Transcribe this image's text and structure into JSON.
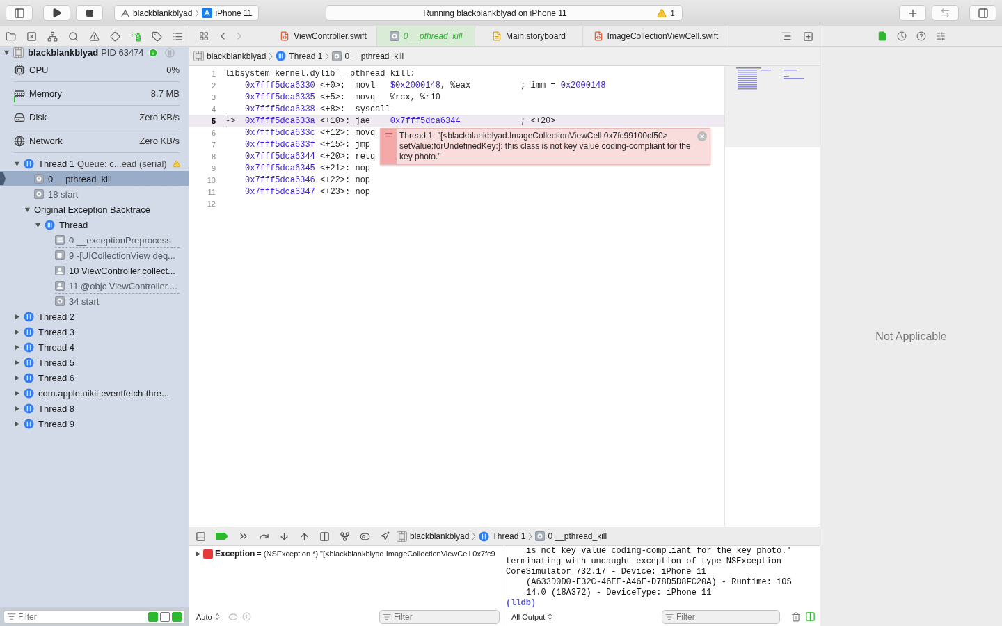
{
  "toolbar": {
    "scheme": {
      "project": "blackblankblyad",
      "device": "iPhone 11"
    },
    "activity": {
      "status": "Running blackblankblyad on iPhone 11",
      "warnings": "1"
    }
  },
  "navigator": {
    "tabs": [
      {
        "kind": "folder",
        "selected": false
      },
      {
        "kind": "source-control",
        "selected": false
      },
      {
        "kind": "symbols",
        "selected": false
      },
      {
        "kind": "find",
        "selected": false
      },
      {
        "kind": "issues",
        "selected": false
      },
      {
        "kind": "tests",
        "selected": false
      },
      {
        "kind": "debug",
        "selected": true
      },
      {
        "kind": "breakpoints",
        "selected": false
      },
      {
        "kind": "reports",
        "selected": false
      }
    ],
    "process": {
      "name": "blackblankblyad",
      "pid": "PID 63474",
      "expanded": true
    },
    "gauges": [
      {
        "kind": "cpu",
        "name": "CPU",
        "value": "0%"
      },
      {
        "kind": "memory",
        "name": "Memory",
        "value": "8.7 MB"
      },
      {
        "kind": "disk",
        "name": "Disk",
        "value": "Zero KB/s"
      },
      {
        "kind": "network",
        "name": "Network",
        "value": "Zero KB/s"
      }
    ],
    "threads": [
      {
        "kind": "thread",
        "label": "Thread 1",
        "detail": "Queue: c...ead (serial)",
        "warning": true,
        "expanded": true,
        "selected": false,
        "children": [
          {
            "kind": "system",
            "label": "0 __pthread_kill",
            "selected": true,
            "dimmed": false,
            "elided_after": true
          },
          {
            "kind": "system",
            "label": "18 start",
            "selected": false,
            "dimmed": true,
            "elided_after": false
          },
          {
            "kind": "group",
            "label": "Original Exception Backtrace",
            "expanded": true,
            "selected": false,
            "children": [
              {
                "kind": "thread",
                "label": "Thread",
                "warning": false,
                "expanded": true,
                "selected": false,
                "children": [
                  {
                    "kind": "exception",
                    "label": "0 __exceptionPreprocess",
                    "selected": false,
                    "dimmed": true,
                    "elided_after": true
                  },
                  {
                    "kind": "library",
                    "label": "9 -[UICollectionView deq...",
                    "selected": false,
                    "dimmed": true,
                    "elided_after": false
                  },
                  {
                    "kind": "user",
                    "label": "10 ViewController.collect...",
                    "selected": false,
                    "dimmed": false,
                    "elided_after": false
                  },
                  {
                    "kind": "user",
                    "label": "11 @objc ViewController....",
                    "selected": false,
                    "dimmed": true,
                    "elided_after": true
                  },
                  {
                    "kind": "system",
                    "label": "34 start",
                    "selected": false,
                    "dimmed": true,
                    "elided_after": false
                  }
                ]
              }
            ]
          }
        ]
      },
      {
        "kind": "thread",
        "label": "Thread 2",
        "warning": false,
        "expanded": false,
        "selected": false
      },
      {
        "kind": "thread",
        "label": "Thread 3",
        "warning": false,
        "expanded": false,
        "selected": false
      },
      {
        "kind": "thread",
        "label": "Thread 4",
        "warning": false,
        "expanded": false,
        "selected": false
      },
      {
        "kind": "thread",
        "label": "Thread 5",
        "warning": false,
        "expanded": false,
        "selected": false
      },
      {
        "kind": "thread",
        "label": "Thread 6",
        "warning": false,
        "expanded": false,
        "selected": false
      },
      {
        "kind": "thread",
        "label": "com.apple.uikit.eventfetch-thre...",
        "warning": false,
        "expanded": false,
        "selected": false
      },
      {
        "kind": "thread",
        "label": "Thread 8",
        "warning": false,
        "expanded": false,
        "selected": false
      },
      {
        "kind": "thread",
        "label": "Thread 9",
        "warning": false,
        "expanded": false,
        "selected": false
      }
    ],
    "filter": {
      "placeholder": "Filter"
    }
  },
  "editor": {
    "tabs": [
      {
        "kind": "swift",
        "label": "ViewController.swift",
        "selected": false
      },
      {
        "kind": "frame",
        "label": "0 __pthread_kill",
        "selected": true
      },
      {
        "kind": "storyboard",
        "label": "Main.storyboard",
        "selected": false
      },
      {
        "kind": "swift",
        "label": "ImageCollectionViewCell.swift",
        "selected": false
      }
    ],
    "jump_bar": [
      {
        "kind": "project",
        "label": "blackblankblyad"
      },
      {
        "kind": "thread",
        "label": "Thread 1"
      },
      {
        "kind": "frame",
        "label": "0 __pthread_kill"
      }
    ],
    "lines": [
      {
        "number": "1",
        "indent": false,
        "current": false,
        "segments": [
          {
            "kind": "plain",
            "text": "libsystem_kernel.dylib`__pthread_kill:"
          }
        ]
      },
      {
        "number": "2",
        "indent": true,
        "current": false,
        "segments": [
          {
            "kind": "number",
            "text": "0x7fff5dca6330"
          },
          {
            "kind": "plain",
            "text": " <+0>:  movl   "
          },
          {
            "kind": "number",
            "text": "$0x2000148"
          },
          {
            "kind": "plain",
            "text": ", %eax          ; imm = "
          },
          {
            "kind": "number",
            "text": "0x2000148"
          }
        ]
      },
      {
        "number": "3",
        "indent": true,
        "current": false,
        "segments": [
          {
            "kind": "number",
            "text": "0x7fff5dca6335"
          },
          {
            "kind": "plain",
            "text": " <+5>:  movq   %rcx, %r10"
          }
        ]
      },
      {
        "number": "4",
        "indent": true,
        "current": false,
        "segments": [
          {
            "kind": "number",
            "text": "0x7fff5dca6338"
          },
          {
            "kind": "plain",
            "text": " <+8>:  syscall"
          }
        ]
      },
      {
        "number": "5",
        "indent": true,
        "current": true,
        "pointer": "->",
        "segments": [
          {
            "kind": "number",
            "text": "0x7fff5dca633a"
          },
          {
            "kind": "plain",
            "text": " <+10>: jae    "
          },
          {
            "kind": "number",
            "text": "0x7fff5dca6344"
          },
          {
            "kind": "plain",
            "text": "            ; <+20>"
          }
        ]
      },
      {
        "number": "6",
        "indent": true,
        "current": false,
        "segments": [
          {
            "kind": "number",
            "text": "0x7fff5dca633c"
          },
          {
            "kind": "plain",
            "text": " <+12>: movq"
          }
        ]
      },
      {
        "number": "7",
        "indent": true,
        "current": false,
        "segments": [
          {
            "kind": "number",
            "text": "0x7fff5dca633f"
          },
          {
            "kind": "plain",
            "text": " <+15>: jmp"
          }
        ]
      },
      {
        "number": "8",
        "indent": true,
        "current": false,
        "segments": [
          {
            "kind": "number",
            "text": "0x7fff5dca6344"
          },
          {
            "kind": "plain",
            "text": " <+20>: retq"
          }
        ]
      },
      {
        "number": "9",
        "indent": true,
        "current": false,
        "segments": [
          {
            "kind": "number",
            "text": "0x7fff5dca6345"
          },
          {
            "kind": "plain",
            "text": " <+21>: nop"
          }
        ]
      },
      {
        "number": "10",
        "indent": true,
        "current": false,
        "segments": [
          {
            "kind": "number",
            "text": "0x7fff5dca6346"
          },
          {
            "kind": "plain",
            "text": " <+22>: nop"
          }
        ]
      },
      {
        "number": "11",
        "indent": true,
        "current": false,
        "segments": [
          {
            "kind": "number",
            "text": "0x7fff5dca6347"
          },
          {
            "kind": "plain",
            "text": " <+23>: nop"
          }
        ]
      },
      {
        "number": "12",
        "current": false
      }
    ],
    "annotation": {
      "message": "Thread 1: \"[<blackblankblyad.ImageCollectionViewCell 0x7fc99100cf50> setValue:forUndefinedKey:]: this class is not key value coding-compliant for the key photo.\""
    }
  },
  "debug_area": {
    "jump_bar": [
      {
        "kind": "project",
        "label": "blackblankblyad"
      },
      {
        "kind": "thread",
        "label": "Thread 1"
      },
      {
        "kind": "frame",
        "label": "0 __pthread_kill"
      }
    ],
    "variables": [
      {
        "name": "Exception",
        "separator": "=",
        "type": "(NSException *)",
        "value": "\"[<blackblankblyad.ImageCollectionViewCell 0x7fc9"
      }
    ],
    "variables_scope": "Auto",
    "variables_filter": {
      "placeholder": "Filter"
    },
    "console": [
      {
        "kind": "continuation",
        "text": "is not key value coding-compliant for the key photo.'"
      },
      {
        "kind": "output",
        "text": "terminating with uncaught exception of type NSException"
      },
      {
        "kind": "output",
        "text": "CoreSimulator 732.17 - Device: iPhone 11"
      },
      {
        "kind": "continuation",
        "text": "(A633D0D0-E32C-46EE-A46E-D78D5D8FC20A) - Runtime: iOS"
      },
      {
        "kind": "continuation",
        "text": "14.0 (18A372) - DeviceType: iPhone 11"
      },
      {
        "kind": "prompt",
        "text": "(lldb)"
      }
    ],
    "console_scope": "All Output",
    "console_filter": {
      "placeholder": "Filter"
    }
  },
  "inspector": {
    "tabs": [
      {
        "kind": "file",
        "selected": true
      },
      {
        "kind": "history",
        "selected": false
      },
      {
        "kind": "help",
        "selected": false
      },
      {
        "kind": "attributes",
        "selected": false
      }
    ],
    "empty_message": "Not Applicable"
  }
}
